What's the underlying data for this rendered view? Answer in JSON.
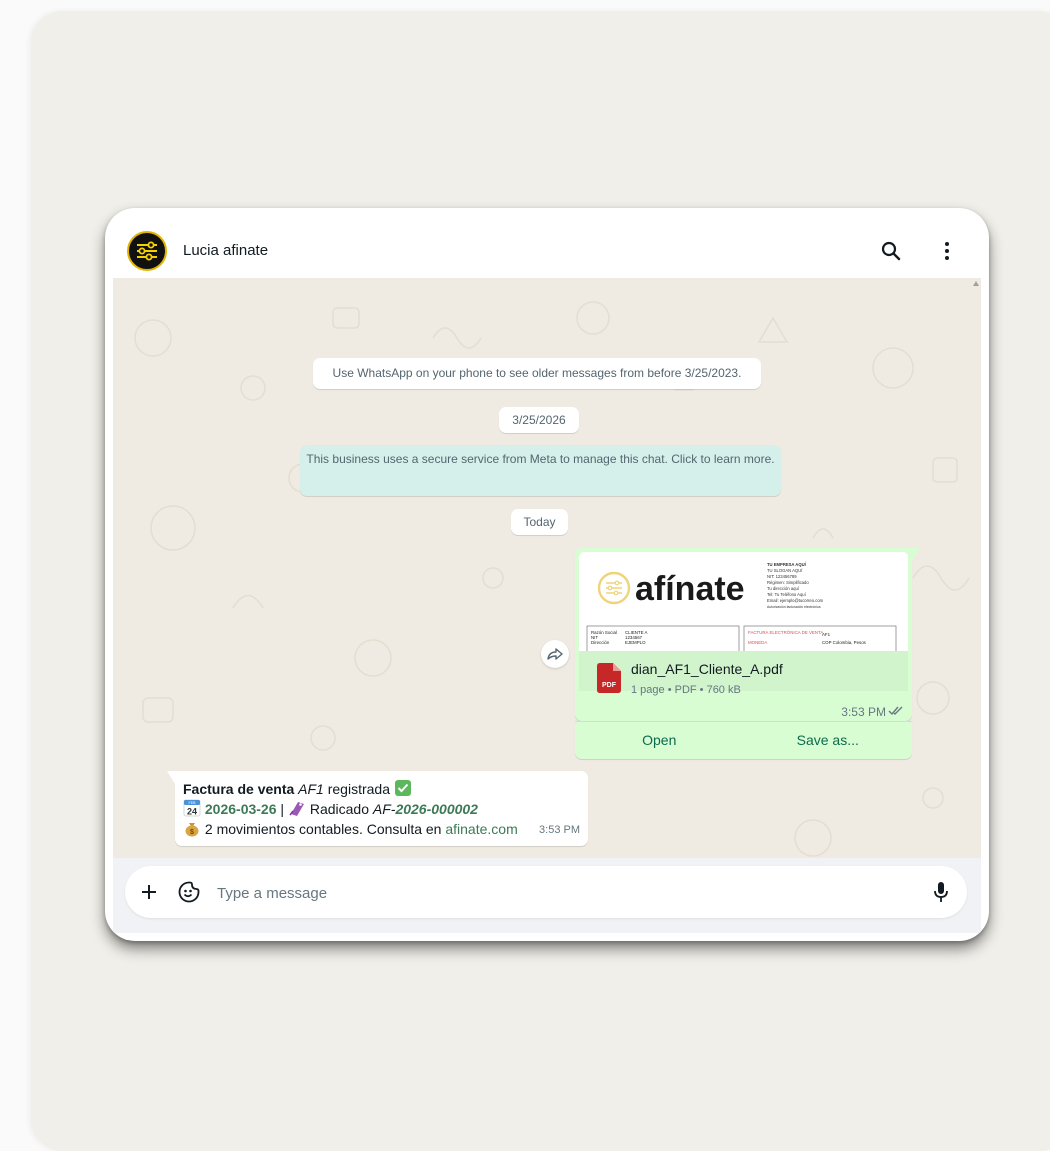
{
  "header": {
    "contact_name": "Lucia afinate",
    "icons": [
      "sliders-logo-icon",
      "search-icon",
      "more-vertical-icon"
    ]
  },
  "chat": {
    "older_messages_note": "Use WhatsApp on your phone to see older messages from before 3/25/2023.",
    "date_chip": "3/25/2026",
    "business_note": "This business uses a secure service from Meta to manage this chat. Click to learn more.",
    "today_chip": "Today",
    "document_message": {
      "preview": {
        "brand": "afínate",
        "company_lines": [
          "TU EMPRESA AQUÍ",
          "TU SLOGAN AQUÍ",
          "NIT: 123456789",
          "Régimen: Simplificado",
          "Tu dirección aquí",
          "Tel: Tu Teléfono Aquí",
          "Email: ejemplo@tucorreo.com",
          "Autorización facturación electrónica"
        ],
        "table_left_labels": [
          "Razón Social",
          "NIT",
          "Dirección"
        ],
        "table_left_values": [
          "CLIENTE A",
          "1234567",
          "EJEMPLO"
        ],
        "table_right_title": "FACTURA ELECTRÓNICA DE VENTA",
        "table_right_value": "AF1",
        "table_right_label2": "MONEDA",
        "table_right_value2": "COP Colombia, Pesos"
      },
      "file_name": "dian_AF1_Cliente_A.pdf",
      "file_meta": "1 page • PDF • 760 kB",
      "pdf_badge": "PDF",
      "time": "3:53 PM",
      "actions": {
        "open": "Open",
        "save_as": "Save as..."
      }
    },
    "incoming_message": {
      "line1": {
        "bold": "Factura de venta",
        "italic": "AF1",
        "text": "registrada"
      },
      "line2": {
        "calendar_month": "FEB",
        "calendar_day": "24",
        "date": "2026-03-26",
        "separator": "|",
        "radicado_label": "Radicado",
        "radicado_prefix": "AF-",
        "radicado_number": "2026-000002"
      },
      "line3": {
        "text": "2 movimientos contables. Consulta en",
        "link": "afinate.com"
      },
      "time": "3:53 PM"
    }
  },
  "composer": {
    "placeholder": "Type a message"
  },
  "colors": {
    "outgoing_bubble": "#d9fdd3",
    "incoming_bubble": "#ffffff",
    "chat_background": "#efeae2",
    "accent_green": "#3d7a55",
    "logo_yellow": "#f5d000"
  }
}
